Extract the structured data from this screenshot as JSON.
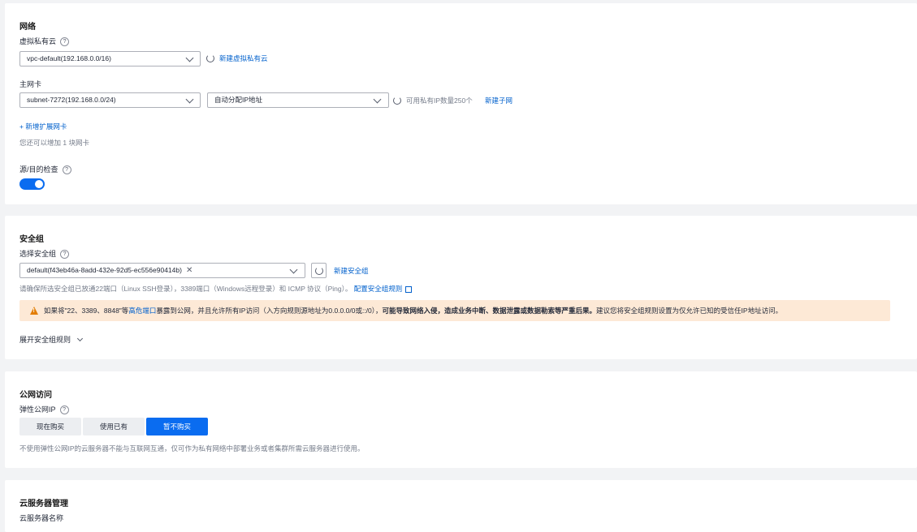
{
  "network": {
    "title": "网络",
    "vpc_label": "虚拟私有云",
    "vpc_value": "vpc-default(192.168.0.0/16)",
    "vpc_create_link": "新建虚拟私有云",
    "nic_label": "主网卡",
    "subnet_value": "subnet-7272(192.168.0.0/24)",
    "ip_mode_value": "自动分配IP地址",
    "available_ip_text": "可用私有IP数量250个",
    "subnet_create_link": "新建子网",
    "add_nic_link": "+ 新增扩展网卡",
    "nic_remaining_text": "您还可以增加 1 块网卡",
    "src_dst_check_label": "源/目的检查"
  },
  "security": {
    "title": "安全组",
    "select_label": "选择安全组",
    "selected_group": "default(f43eb46a-8add-432e-92d5-ec556e90414b)",
    "create_link": "新建安全组",
    "hint_text": "请确保所选安全组已放通22端口（Linux SSH登录），3389端口（Windows远程登录）和 ICMP 协议（Ping）。",
    "hint_link": "配置安全组规则",
    "warning_part1": "如果将\"22、3389、8848\"等",
    "warning_link": "高危端口",
    "warning_part2": "暴露到公网，并且允许所有IP访问（入方向规则源地址为0.0.0.0/0或::/0），",
    "warning_bold": "可能导致网络入侵，造成业务中断、数据泄露或数据勒索等严重后果。",
    "warning_part3": "建议您将安全组规则设置为仅允许已知的受信任IP地址访问。",
    "expand_rules": "展开安全组规则"
  },
  "public": {
    "title": "公网访问",
    "eip_label": "弹性公网IP",
    "options": [
      "现在购买",
      "使用已有",
      "暂不购买"
    ],
    "note": "不使用弹性公网IP的云服务器不能与互联网互通，仅可作为私有网络中部署业务或者集群所需云服务器进行使用。"
  },
  "server": {
    "title": "云服务器管理",
    "name_label": "云服务器名称"
  },
  "colors": {
    "accent": "#0a6cf0",
    "link": "#0060cc",
    "warning_bg": "#fde9d6",
    "warning_icon": "#e37d00"
  }
}
